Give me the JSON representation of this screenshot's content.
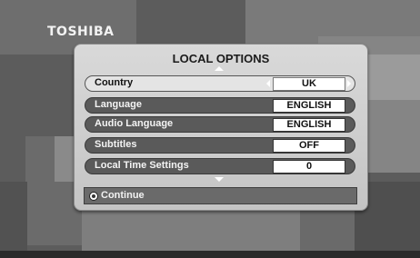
{
  "brand": {
    "logo_text": "TOSHIBA"
  },
  "dialog": {
    "title": "LOCAL OPTIONS",
    "rows": [
      {
        "label": "Country",
        "value": "UK",
        "selected": true
      },
      {
        "label": "Language",
        "value": "ENGLISH",
        "selected": false
      },
      {
        "label": "Audio Language",
        "value": "ENGLISH",
        "selected": false
      },
      {
        "label": "Subtitles",
        "value": "OFF",
        "selected": false
      },
      {
        "label": "Local Time Settings",
        "value": "0",
        "selected": false
      }
    ],
    "footer_label": "Continue"
  },
  "colors": {
    "dialog_bg": "#cfcfcf",
    "row_bg": "#5a5a5a",
    "selected_row_bg": "#e4e4e4",
    "value_box_bg": "#ffffff"
  },
  "icons": {
    "scroll_up": "arrow-up-icon",
    "scroll_down": "arrow-down-icon",
    "value_left": "triangle-left-icon",
    "value_right": "triangle-right-icon",
    "footer": "dpad-icon"
  }
}
